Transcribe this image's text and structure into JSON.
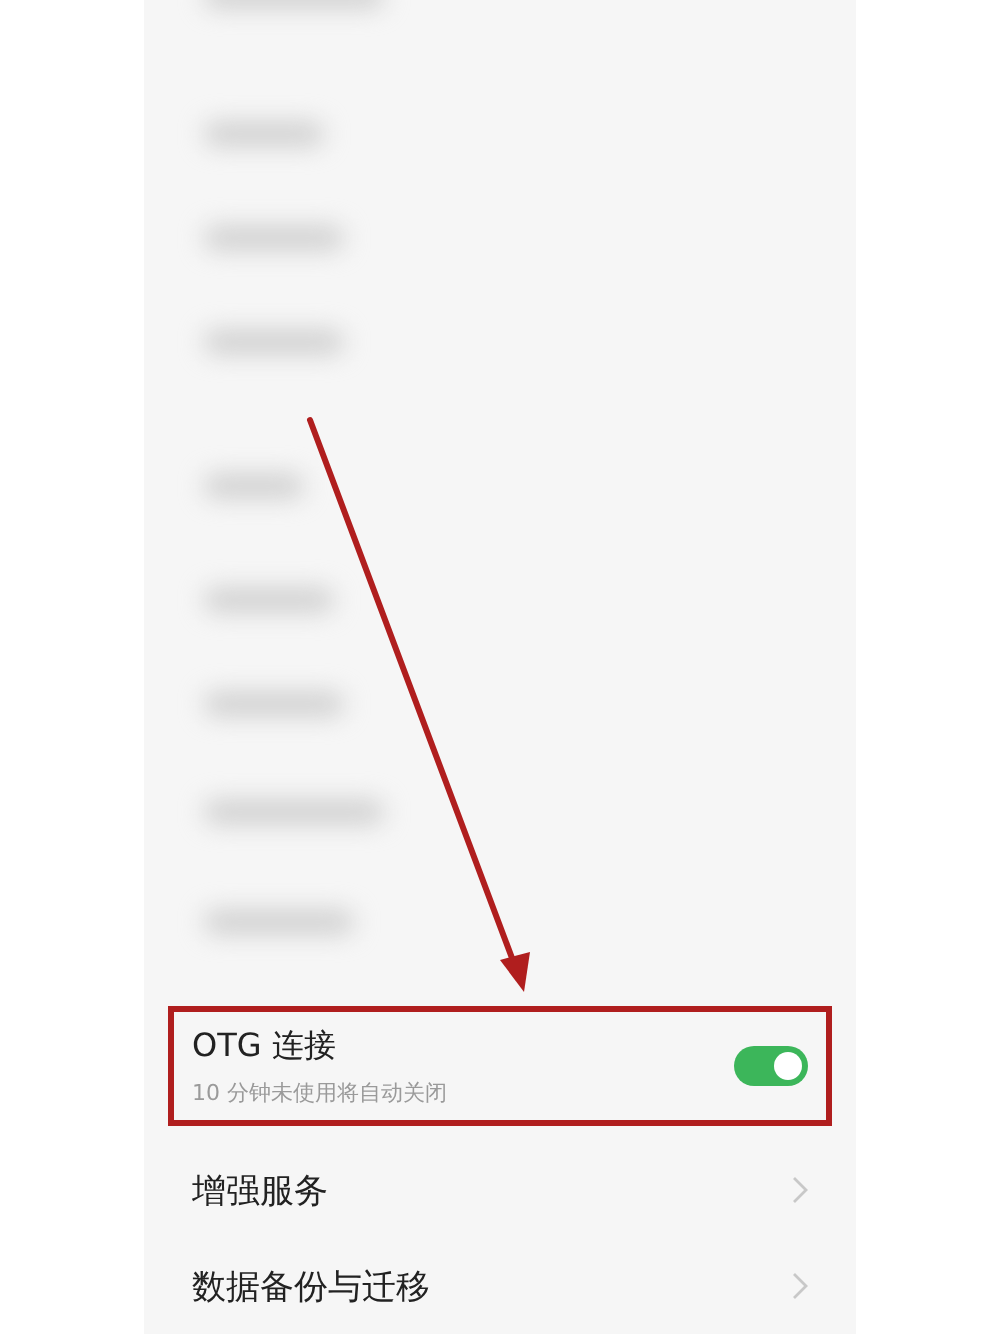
{
  "settings": [
    {
      "kind": "toggle",
      "title": "OTG 连接",
      "subtitle": "10 分钟未使用将自动关闭",
      "on": true,
      "highlighted": true
    },
    {
      "kind": "link",
      "title": "增强服务",
      "highlighted": false
    },
    {
      "kind": "link",
      "title": "数据备份与迁移",
      "highlighted": false
    }
  ]
}
